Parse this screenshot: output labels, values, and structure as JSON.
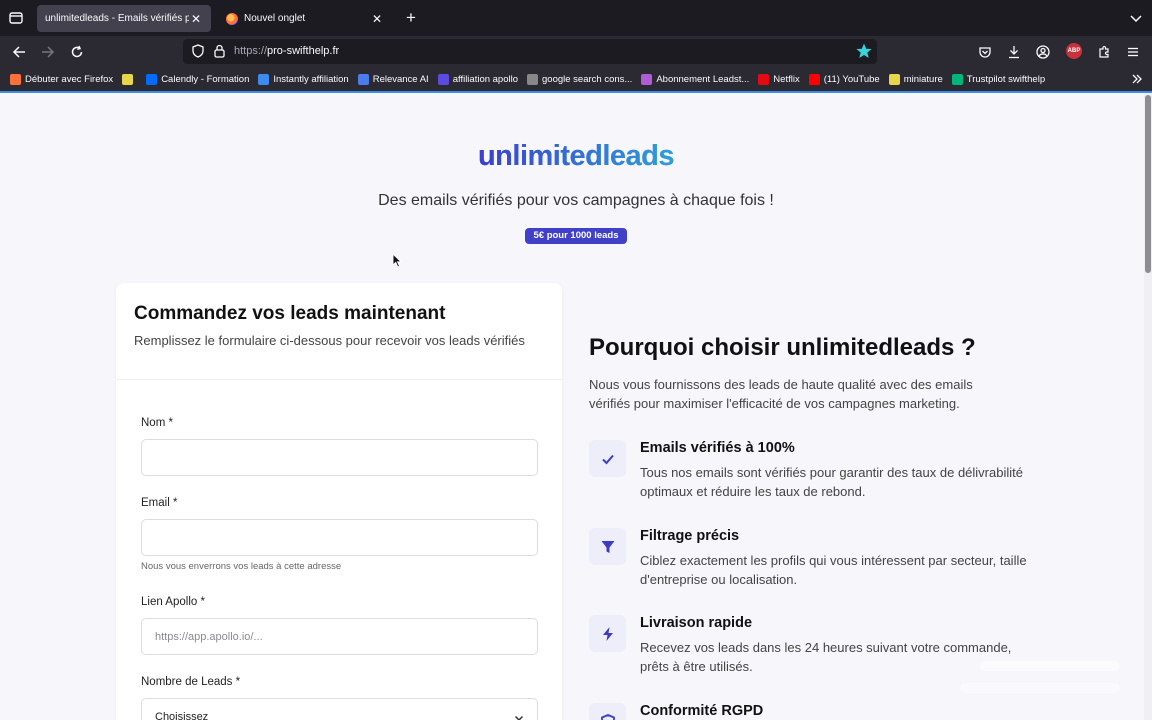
{
  "browser": {
    "tabs": [
      {
        "title": "unlimitedleads - Emails vérifiés pour",
        "active": true
      },
      {
        "title": "Nouvel onglet",
        "active": false
      }
    ],
    "url": {
      "scheme": "https://",
      "host": "pro-swifthelp.fr"
    },
    "bookmarks": [
      {
        "label": "Débuter avec Firefox",
        "color": "#ff7139"
      },
      {
        "label": "",
        "color": "#e8d64a"
      },
      {
        "label": "Calendly - Formation",
        "color": "#006bff"
      },
      {
        "label": "Instantly affiliation",
        "color": "#3c8cf0"
      },
      {
        "label": "Relevance AI",
        "color": "#4b7bec"
      },
      {
        "label": "affiliation apollo",
        "color": "#5b4be0"
      },
      {
        "label": "google search cons...",
        "color": "#888888"
      },
      {
        "label": "Abonnement Leadst...",
        "color": "#b05cd6"
      },
      {
        "label": "Netflix",
        "color": "#e50914"
      },
      {
        "label": "(11) YouTube",
        "color": "#ff0000"
      },
      {
        "label": "miniature",
        "color": "#e8d64a"
      },
      {
        "label": "Trustpilot swifthelp",
        "color": "#00b67a"
      }
    ]
  },
  "hero": {
    "title": "unlimitedleads",
    "subtitle": "Des emails vérifiés pour vos campagnes à chaque fois !",
    "badge": "5€ pour 1000 leads"
  },
  "form": {
    "title": "Commandez vos leads maintenant",
    "description": "Remplissez le formulaire ci-dessous pour recevoir vos leads vérifiés",
    "fields": {
      "name_label": "Nom *",
      "email_label": "Email *",
      "email_hint": "Nous vous enverrons vos leads à cette adresse",
      "apollo_label": "Lien Apollo *",
      "apollo_placeholder": "https://app.apollo.io/...",
      "leads_label": "Nombre de Leads *",
      "leads_value": "Choisissez"
    }
  },
  "why": {
    "title": "Pourquoi choisir unlimitedleads ?",
    "description": "Nous vous fournissons des leads de haute qualité avec des emails vérifiés pour maximiser l'efficacité de vos campagnes marketing.",
    "features": [
      {
        "icon": "check-icon",
        "title": "Emails vérifiés à 100%",
        "text": "Tous nos emails sont vérifiés pour garantir des taux de délivrabilité optimaux et réduire les taux de rebond."
      },
      {
        "icon": "filter-icon",
        "title": "Filtrage précis",
        "text": "Ciblez exactement les profils qui vous intéressent par secteur, taille d'entreprise ou localisation."
      },
      {
        "icon": "lightning-icon",
        "title": "Livraison rapide",
        "text": "Recevez vos leads dans les 24 heures suivant votre commande, prêts à être utilisés."
      },
      {
        "icon": "shield-icon",
        "title": "Conformité RGPD",
        "text": ""
      }
    ]
  },
  "colors": {
    "accent": "#4141c8",
    "brand_gradient_start": "#3538c9",
    "brand_gradient_end": "#1aa3d6",
    "browser_dark": "#1c1b22"
  }
}
